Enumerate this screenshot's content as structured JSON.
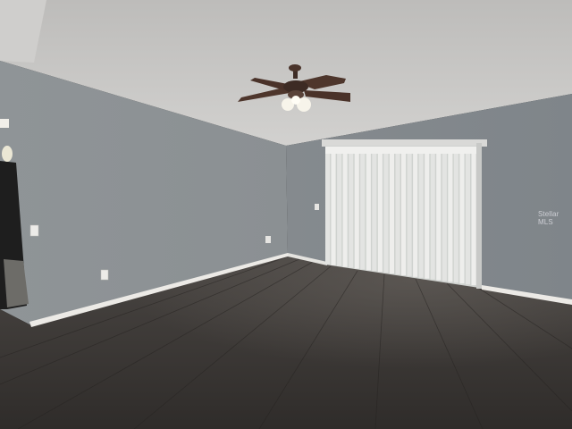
{
  "watermark": {
    "text": "Stellar MLS"
  },
  "colors": {
    "ceiling": "#c9c8c6",
    "wall_left": "#8e9396",
    "wall_back": "#858b8f",
    "floor": "#3a3633",
    "baseboard": "#ecebe8",
    "blinds": "#e8e8e6",
    "fan_blade": "#4a342b"
  },
  "icons": [
    "ceiling-fan-icon",
    "light-fixture-icon",
    "vertical-blinds-icon",
    "outlet-icon",
    "light-switch-icon"
  ]
}
